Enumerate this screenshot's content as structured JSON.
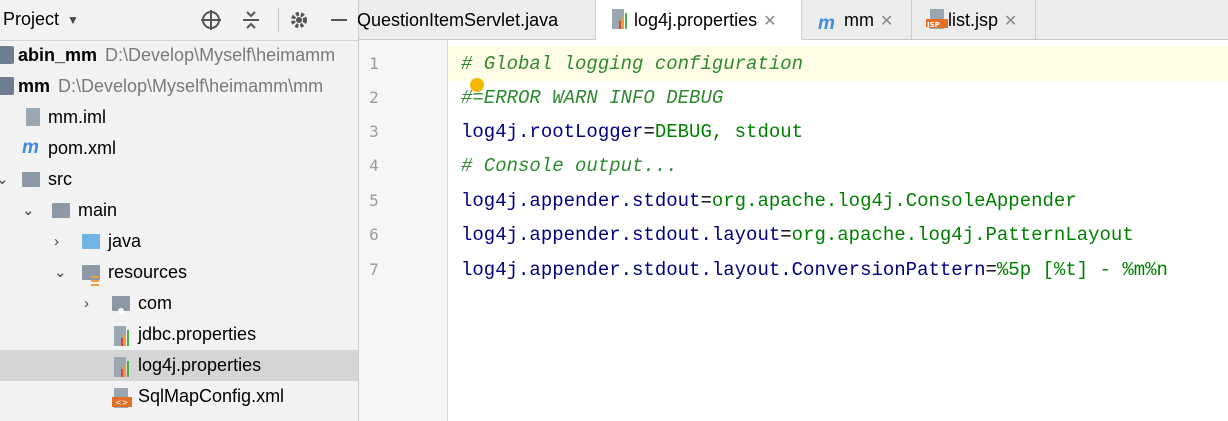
{
  "project_panel": {
    "title": "Project",
    "tree": [
      {
        "label": "abin_mm",
        "path": "D:\\Develop\\Myself\\heimamm",
        "icon": "module-icon",
        "bold": true
      },
      {
        "label": "mm",
        "path": "D:\\Develop\\Myself\\heimamm\\mm",
        "icon": "module-icon",
        "bold": true
      },
      {
        "label": "mm.iml",
        "icon": "iml-file-icon"
      },
      {
        "label": "pom.xml",
        "icon": "maven-icon"
      },
      {
        "label": "src",
        "icon": "folder-icon"
      },
      {
        "label": "main",
        "icon": "folder-icon"
      },
      {
        "label": "java",
        "icon": "source-folder-icon"
      },
      {
        "label": "resources",
        "icon": "resources-folder-icon"
      },
      {
        "label": "com",
        "icon": "package-icon"
      },
      {
        "label": "jdbc.properties",
        "icon": "properties-file-icon"
      },
      {
        "label": "log4j.properties",
        "icon": "properties-file-icon",
        "selected": true
      },
      {
        "label": "SqlMapConfig.xml",
        "icon": "xml-file-icon"
      }
    ]
  },
  "tabs": [
    {
      "label": "QuestionItemServlet.java",
      "icon": "java-class-icon"
    },
    {
      "label": "log4j.properties",
      "icon": "properties-file-icon",
      "active": true
    },
    {
      "label": "mm",
      "icon": "maven-icon"
    },
    {
      "label": "list.jsp",
      "icon": "jsp-file-icon"
    }
  ],
  "icon_glyphs": {
    "close": "✕"
  },
  "editor": {
    "line_numbers": [
      "1",
      "2",
      "3",
      "4",
      "5",
      "6",
      "7"
    ],
    "lines": [
      {
        "comment": "# Global logging configuration"
      },
      {
        "comment": "#=ERROR WARN INFO DEBUG"
      },
      {
        "key": "log4j.rootLogger",
        "eq": "=",
        "value": "DEBUG, stdout"
      },
      {
        "comment": "# Console output..."
      },
      {
        "key": "log4j.appender.stdout",
        "eq": "=",
        "value": "org.apache.log4j.ConsoleAppender"
      },
      {
        "key": "log4j.appender.stdout.layout",
        "eq": "=",
        "value": "org.apache.log4j.PatternLayout"
      },
      {
        "key": "log4j.appender.stdout.layout.ConversionPattern",
        "eq": "=",
        "value": "%5p [%t] - %m%n"
      }
    ]
  },
  "colors": {
    "comment": "#2f8a2f",
    "key": "#000080",
    "value": "#008000",
    "current_line": "#fffde6"
  }
}
